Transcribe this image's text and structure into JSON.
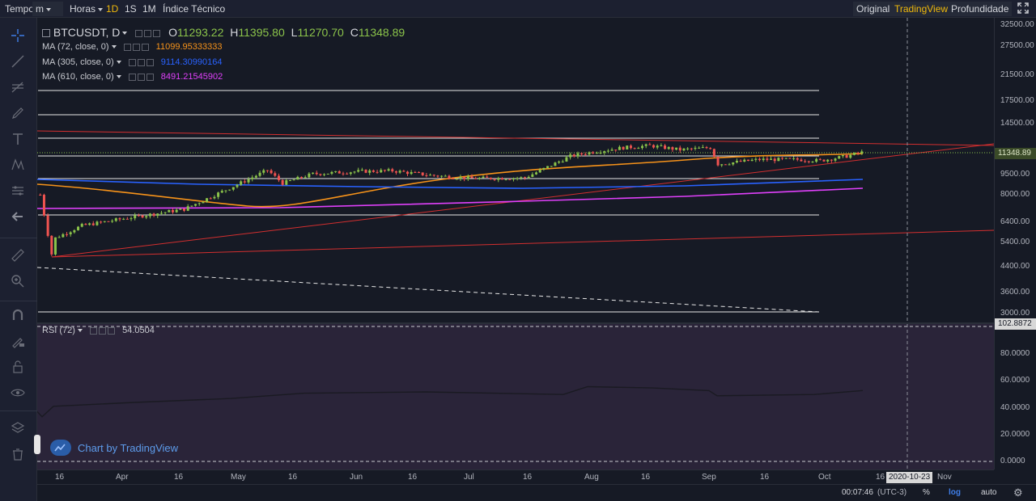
{
  "toolbar": {
    "tempo": "Tempo",
    "minutes": "m",
    "hours": "Horas",
    "intervals": [
      "1D",
      "1S",
      "1M"
    ],
    "active_interval": "1D",
    "indicators": "Índice Técnico",
    "views": [
      "Original",
      "TradingView",
      "Profundidade"
    ],
    "active_view": "TradingView",
    "fullscreen_icon": "fullscreen-icon"
  },
  "legend": {
    "symbol": "BTCUSDT, D",
    "o_label": "O",
    "o_value": "11293.22",
    "h_label": "H",
    "h_value": "11395.80",
    "l_label": "L",
    "l_value": "11270.70",
    "c_label": "C",
    "c_value": "11348.89",
    "ma": [
      {
        "name": "MA (72, close, 0)",
        "value": "11099.95333333",
        "color": "#f7931a"
      },
      {
        "name": "MA (305, close, 0)",
        "value": "9114.30990164",
        "color": "#2962ff"
      },
      {
        "name": "MA (610, close, 0)",
        "value": "8491.21545902",
        "color": "#e040fb"
      }
    ]
  },
  "price_axis": {
    "ticks": [
      "32500.00",
      "27500.00",
      "21500.00",
      "17500.00",
      "14500.00",
      "11500.00",
      "9500.00",
      "8000.00",
      "6400.00",
      "5400.00",
      "4400.00",
      "3600.00",
      "3000.00"
    ],
    "current_price": "11348.89",
    "rsi_top": "102.8872",
    "rsi_ticks": [
      "80.0000",
      "60.0000",
      "40.0000",
      "20.0000",
      "0.0000"
    ]
  },
  "time_axis": {
    "labels": [
      "16",
      "Apr",
      "16",
      "May",
      "16",
      "Jun",
      "16",
      "Jul",
      "16",
      "Aug",
      "16",
      "Sep",
      "16",
      "Oct",
      "16",
      "Nov"
    ],
    "crosshair_date": "2020-10-23"
  },
  "rsi": {
    "name": "RSI (72)",
    "value": "54.0504"
  },
  "watermark": "Chart by TradingView",
  "bottom": {
    "time": "00:07:46",
    "tz": "(UTC-3)",
    "percent": "%",
    "log": "log",
    "auto": "auto"
  },
  "colors": {
    "up": "#8bc34a",
    "down": "#ef5350",
    "accent": "#f0b90b",
    "trend": "#d32f2f"
  },
  "chart_data": {
    "type": "candlestick",
    "scale": "log",
    "x_start": "2020-03-09",
    "x_labels": [
      "16",
      "Apr",
      "16",
      "May",
      "16",
      "Jun",
      "16",
      "Jul",
      "16",
      "Aug",
      "16",
      "Sep",
      "16",
      "Oct",
      "16",
      "Nov"
    ],
    "y_ticks": [
      32500,
      27500,
      21500,
      17500,
      14500,
      11500,
      9500,
      8000,
      6400,
      5400,
      4400,
      3600,
      3000
    ],
    "last": {
      "open": 11293.22,
      "high": 11395.8,
      "low": 11270.7,
      "close": 11348.89
    },
    "close_path": [
      [
        "2020-03-09",
        8000
      ],
      [
        "2020-03-12",
        4900
      ],
      [
        "2020-03-13",
        5600
      ],
      [
        "2020-03-20",
        6200
      ],
      [
        "2020-04-01",
        6600
      ],
      [
        "2020-04-16",
        7100
      ],
      [
        "2020-04-30",
        8700
      ],
      [
        "2020-05-08",
        9800
      ],
      [
        "2020-05-12",
        8800
      ],
      [
        "2020-05-20",
        9500
      ],
      [
        "2020-06-01",
        9700
      ],
      [
        "2020-06-10",
        9750
      ],
      [
        "2020-06-20",
        9400
      ],
      [
        "2020-07-01",
        9150
      ],
      [
        "2020-07-15",
        9200
      ],
      [
        "2020-07-27",
        11000
      ],
      [
        "2020-08-02",
        11400
      ],
      [
        "2020-08-10",
        11800
      ],
      [
        "2020-08-17",
        12000
      ],
      [
        "2020-08-25",
        11600
      ],
      [
        "2020-09-02",
        11800
      ],
      [
        "2020-09-04",
        10300
      ],
      [
        "2020-09-15",
        10700
      ],
      [
        "2020-09-25",
        10700
      ],
      [
        "2020-10-01",
        10600
      ],
      [
        "2020-10-08",
        11000
      ],
      [
        "2020-10-12",
        11348.89
      ]
    ],
    "ma": [
      {
        "name": "MA (72, close, 0)",
        "value": 11099.95333333
      },
      {
        "name": "MA (305, close, 0)",
        "value": 9114.30990164
      },
      {
        "name": "MA (610, close, 0)",
        "value": 8491.21545902
      }
    ],
    "rsi": {
      "name": "RSI (72)",
      "last": 54.0504,
      "range": [
        0,
        102.8872
      ]
    }
  }
}
